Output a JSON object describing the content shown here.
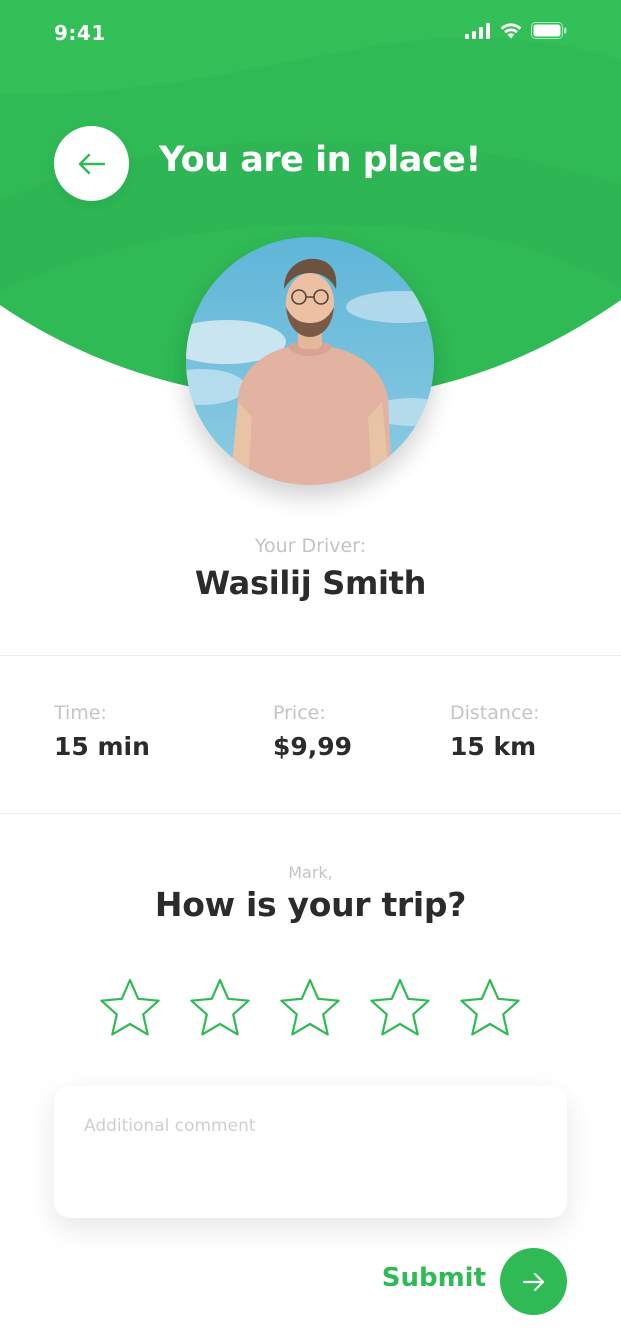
{
  "colors": {
    "accent": "#2fba55",
    "text": "#2b2b2b",
    "muted": "#c4c4c4",
    "background": "#ffffff"
  },
  "status_bar": {
    "time": "9:41",
    "icons": [
      "cellular-signal-icon",
      "wifi-icon",
      "battery-icon"
    ]
  },
  "header": {
    "back_icon": "arrow-left-icon",
    "title": "You are in place!"
  },
  "driver": {
    "caption": "Your Driver:",
    "name": "Wasilij Smith"
  },
  "stats": [
    {
      "label": "Time:",
      "value": "15 min"
    },
    {
      "label": "Price:",
      "value": "$9,99"
    },
    {
      "label": "Distance:",
      "value": "15 km"
    }
  ],
  "rating": {
    "caption": "Mark,",
    "question": "How is your trip?",
    "max_stars": 5,
    "selected": 0,
    "star_icon": "star-outline-icon"
  },
  "comment": {
    "placeholder": "Additional comment",
    "value": ""
  },
  "submit": {
    "label": "Submit",
    "icon": "arrow-right-icon"
  }
}
